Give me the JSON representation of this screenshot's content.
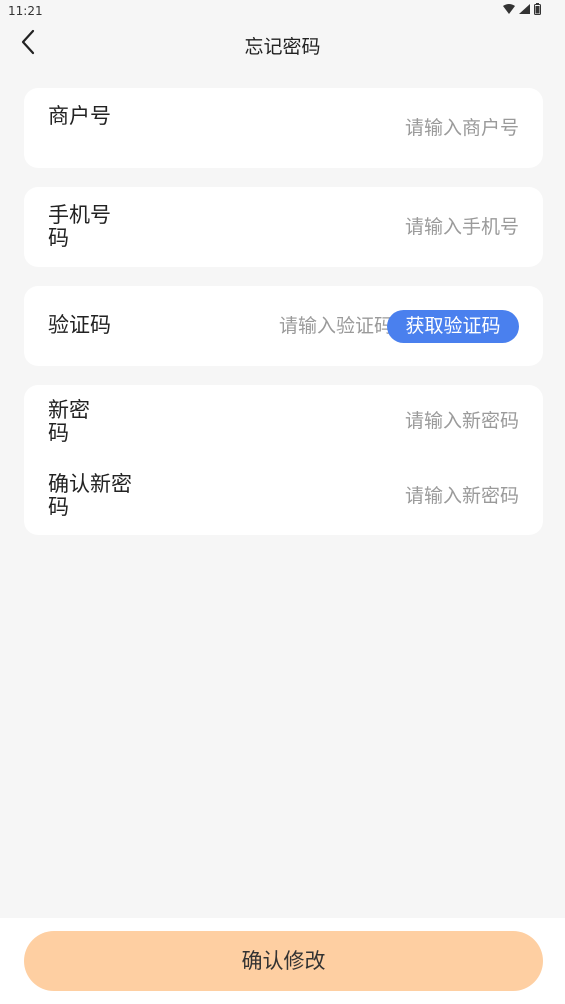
{
  "status_bar": {
    "time": "11:21"
  },
  "header": {
    "title": "忘记密码"
  },
  "form": {
    "merchant": {
      "label": "商户号",
      "placeholder": "请输入商户号"
    },
    "phone": {
      "label": "手机号码",
      "placeholder": "请输入手机号"
    },
    "code": {
      "label": "验证码",
      "placeholder": "请输入验证码",
      "button": "获取验证码"
    },
    "new_password": {
      "label": "新密码",
      "placeholder": "请输入新密码"
    },
    "confirm_password": {
      "label": "确认新密码",
      "placeholder": "请输入新密码"
    }
  },
  "footer": {
    "confirm_label": "确认修改"
  },
  "colors": {
    "accent": "#4a80ee",
    "confirm": "#fecfa2",
    "background": "#f6f6f6"
  }
}
